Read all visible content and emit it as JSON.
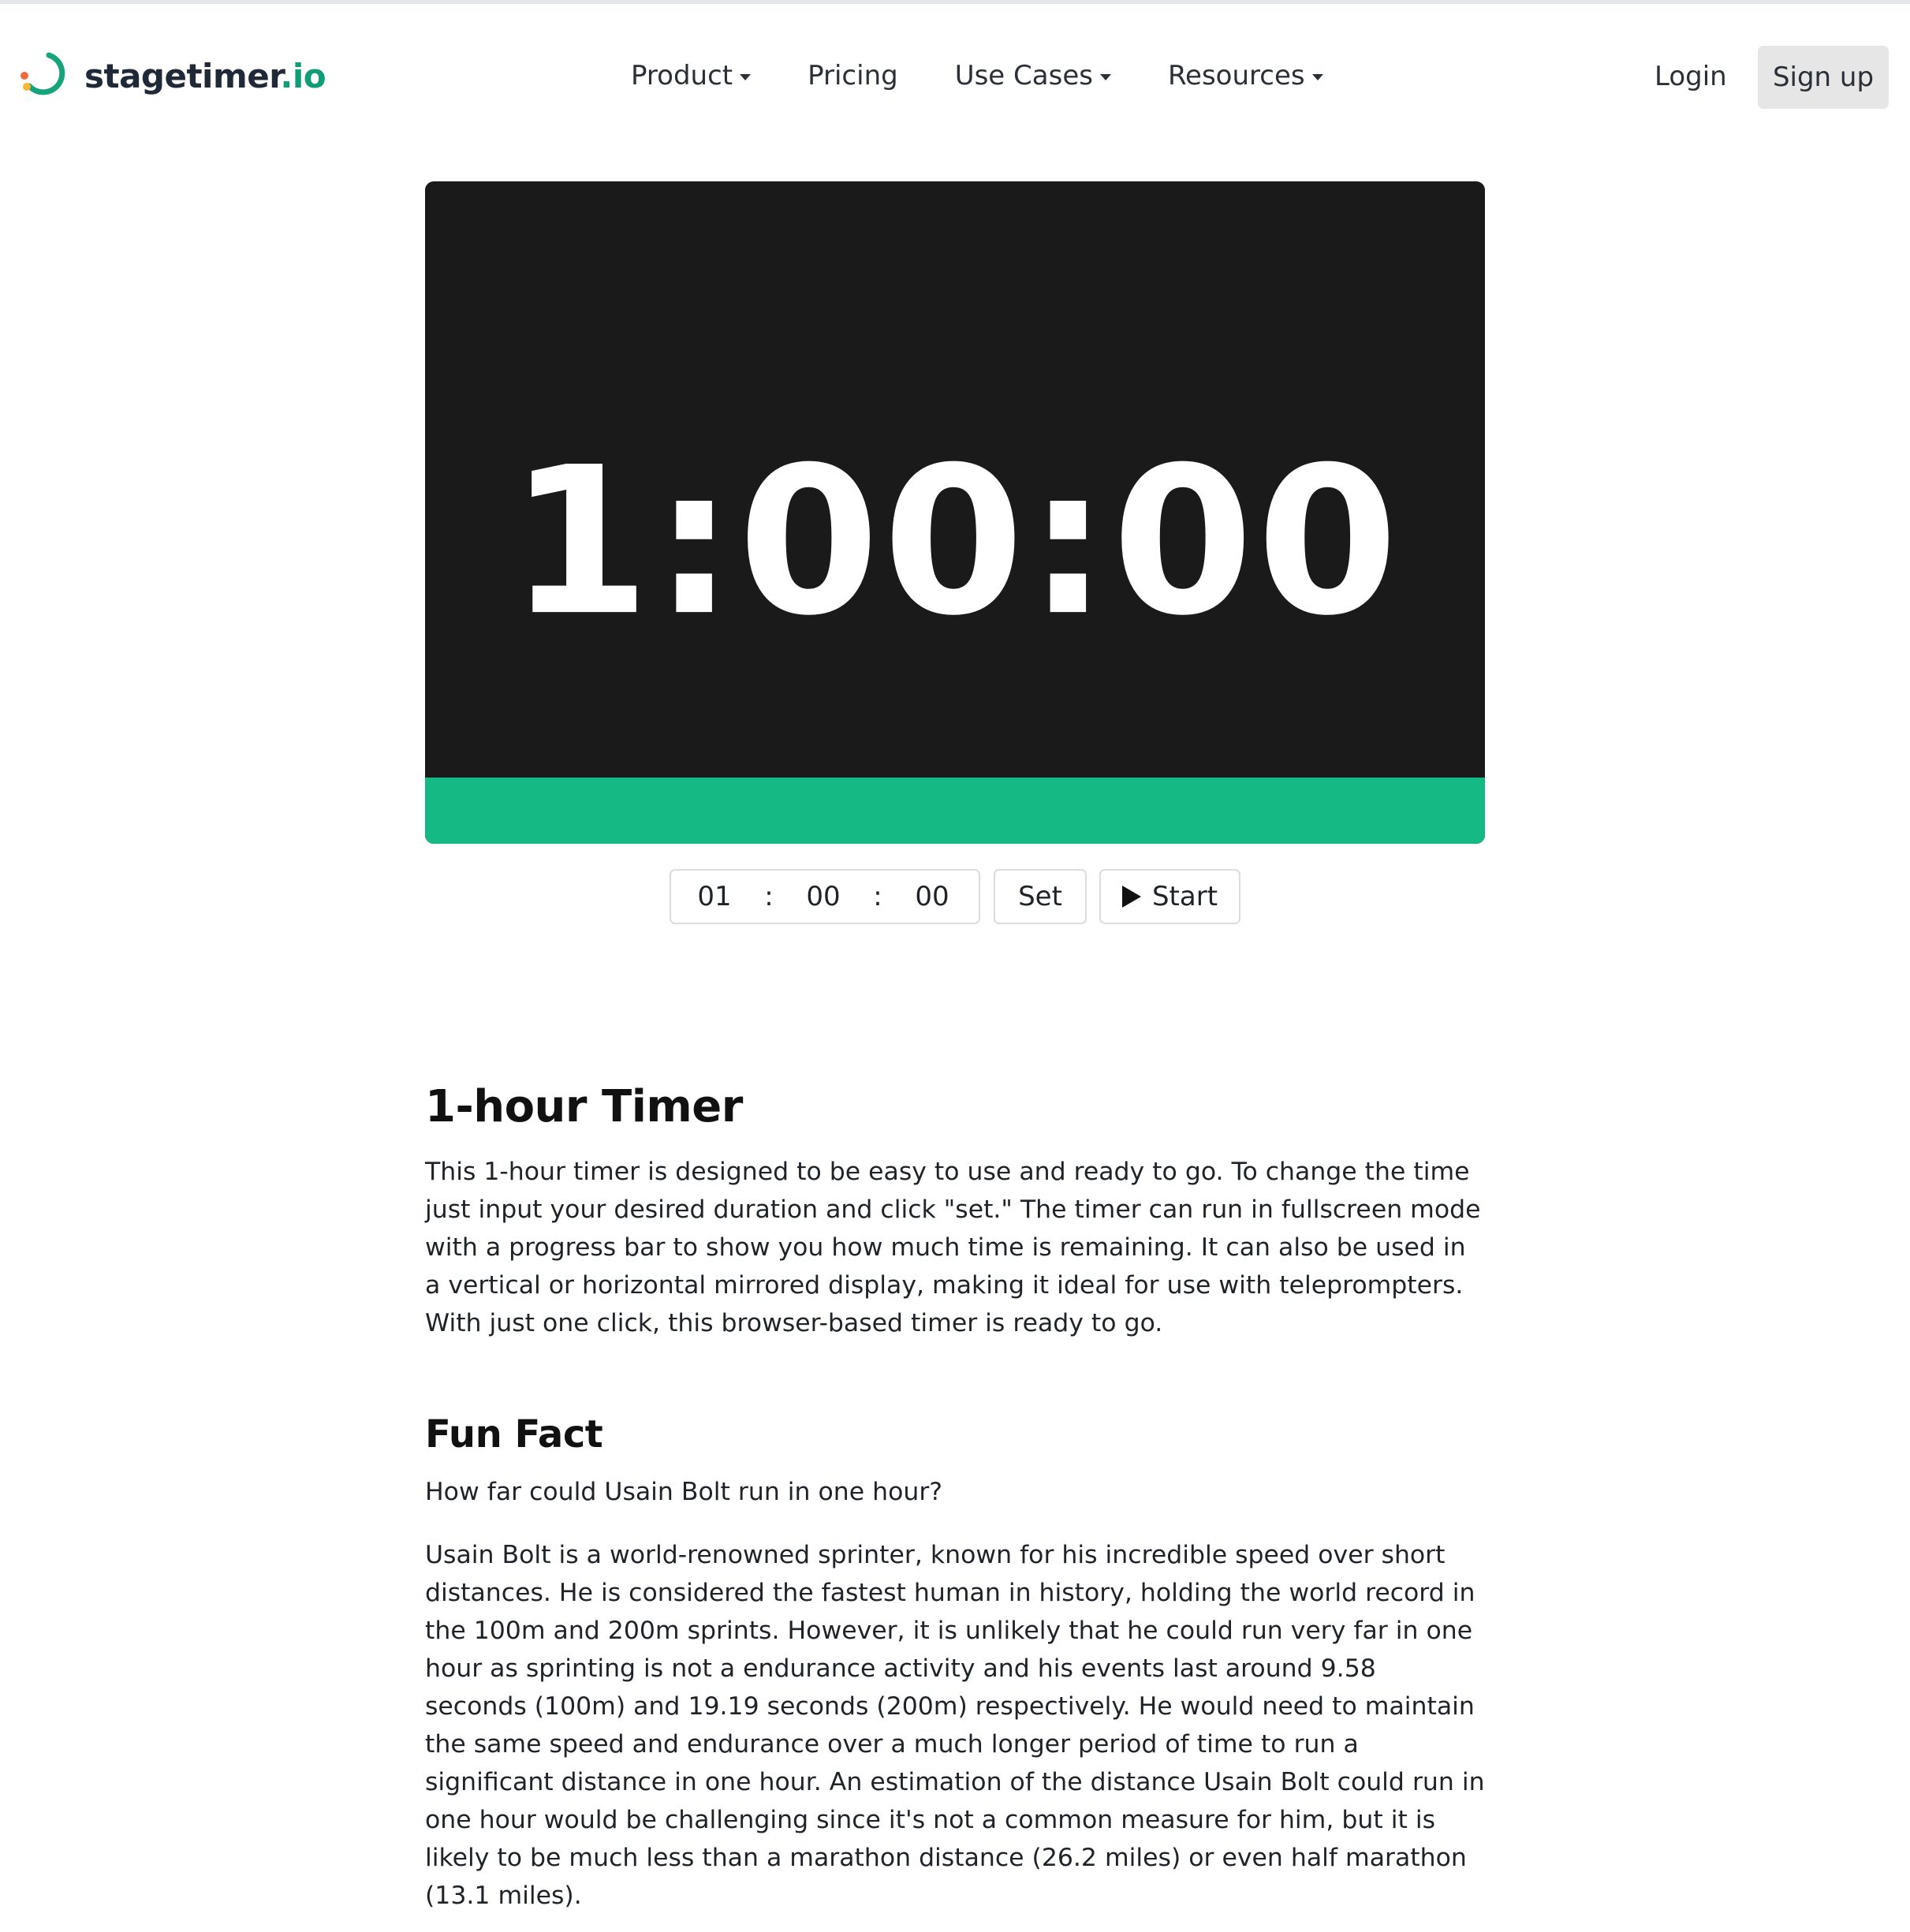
{
  "header": {
    "logo": {
      "name": "stagetimer",
      "tld": ".io"
    },
    "nav": [
      {
        "label": "Product",
        "dropdown": true
      },
      {
        "label": "Pricing",
        "dropdown": false
      },
      {
        "label": "Use Cases",
        "dropdown": true
      },
      {
        "label": "Resources",
        "dropdown": true
      }
    ],
    "login_label": "Login",
    "signup_label": "Sign up"
  },
  "timer": {
    "display": "1:00:00",
    "progress_percent": 100,
    "colors": {
      "background": "#1a1a1a",
      "progress": "#14b984",
      "text": "#ffffff"
    }
  },
  "controls": {
    "hours": "01",
    "minutes": "00",
    "seconds": "00",
    "separator": ":",
    "set_label": "Set",
    "start_label": "Start"
  },
  "article": {
    "title": "1-hour Timer",
    "intro": "This 1-hour timer is designed to be easy to use and ready to go. To change the time just input your desired duration and click \"set.\" The timer can run in fullscreen mode with a progress bar to show you how much time is remaining. It can also be used in a vertical or horizontal mirrored display, making it ideal for use with teleprompters. With just one click, this browser-based timer is ready to go.",
    "fun_fact_title": "Fun Fact",
    "fun_fact_question": "How far could Usain Bolt run in one hour?",
    "fun_fact_answer": "Usain Bolt is a world-renowned sprinter, known for his incredible speed over short distances. He is considered the fastest human in history, holding the world record in the 100m and 200m sprints. However, it is unlikely that he could run very far in one hour as sprinting is not a endurance activity and his events last around 9.58 seconds (100m) and 19.19 seconds (200m) respectively. He would need to maintain the same speed and endurance over a much longer period of time to run a significant distance in one hour. An estimation of the distance Usain Bolt could run in one hour would be challenging since it's not a common measure for him, but it is likely to be much less than a marathon distance (26.2 miles) or even half marathon (13.1 miles)."
  },
  "icons": {
    "logo": "stagetimer-logo-icon",
    "caret": "chevron-down-icon",
    "play": "play-icon"
  }
}
